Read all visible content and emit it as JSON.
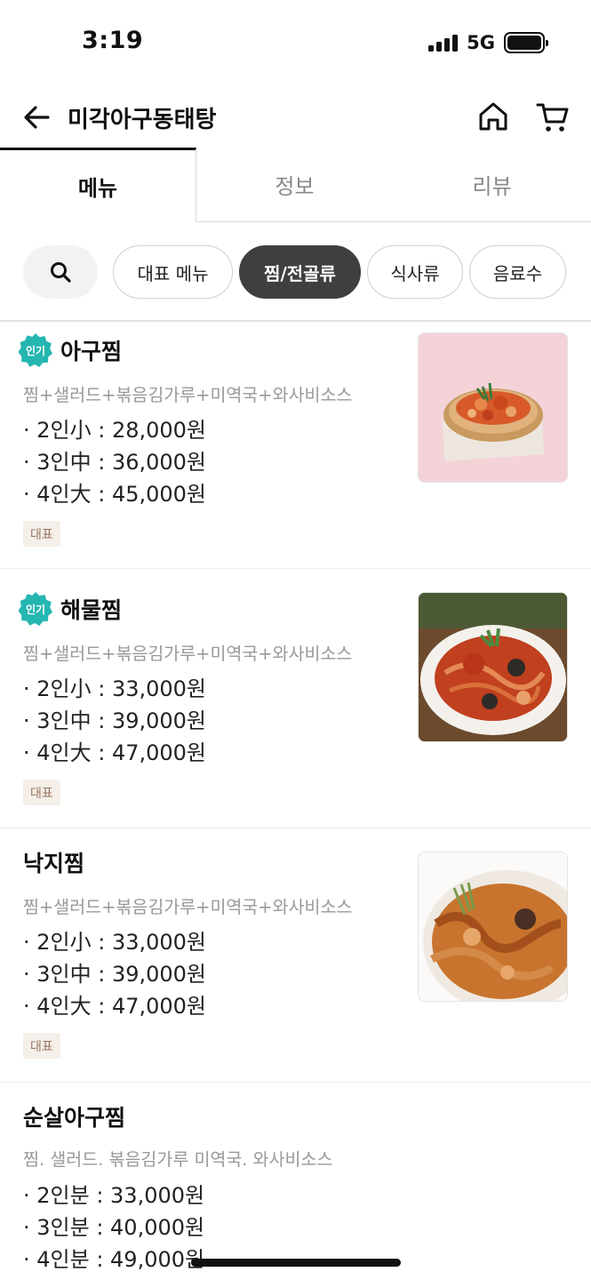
{
  "status": {
    "time": "3:19",
    "network": "5G"
  },
  "header": {
    "title": "미각아구동태탕"
  },
  "tabs": [
    {
      "label": "메뉴",
      "active": true
    },
    {
      "label": "정보",
      "active": false
    },
    {
      "label": "리뷰",
      "active": false
    }
  ],
  "filters": [
    {
      "label": "대표 메뉴",
      "active": false
    },
    {
      "label": "찜/전골류",
      "active": true
    },
    {
      "label": "식사류",
      "active": false
    },
    {
      "label": "음료수",
      "active": false
    }
  ],
  "menu_items": [
    {
      "badge": "인기",
      "name": "아구찜",
      "desc": "찜+샐러드+볶음김가루+미역국+와사비소스",
      "prices": [
        "· 2인小 : 28,000원",
        "· 3인中 : 36,000원",
        "· 4인大 : 45,000원"
      ],
      "tag": "대표",
      "image": "braised-monkfish-photo"
    },
    {
      "badge": "인기",
      "name": "해물찜",
      "desc": "찜+샐러드+볶음김가루+미역국+와사비소스",
      "prices": [
        "· 2인小 : 33,000원",
        "· 3인中 : 39,000원",
        "· 4인大 : 47,000원"
      ],
      "tag": "대표",
      "image": "braised-seafood-photo"
    },
    {
      "badge": "",
      "name": "낙지찜",
      "desc": "찜+샐러드+볶음김가루+미역국+와사비소스",
      "prices": [
        "· 2인小 : 33,000원",
        "· 3인中 : 39,000원",
        "· 4인大 : 47,000원"
      ],
      "tag": "대표",
      "image": "braised-octopus-photo"
    },
    {
      "badge": "",
      "name": "순살아구찜",
      "desc": "찜. 샐러드. 볶음김가루 미역국. 와사비소스",
      "prices": [
        "· 2인분 : 33,000원",
        "· 3인분 : 40,000원",
        "· 4인분 : 49,000원"
      ],
      "tag": "",
      "image": ""
    }
  ],
  "colors": {
    "popular_badge": "#25b6b0",
    "active_chip": "#3f3f3f",
    "rep_tag_bg": "#f5efe9",
    "rep_tag_text": "#9a7660"
  }
}
